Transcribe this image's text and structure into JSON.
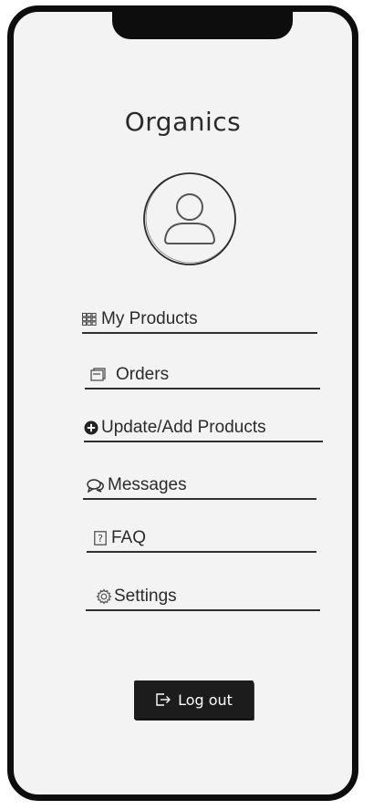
{
  "app": {
    "title": "Organics"
  },
  "menu": {
    "items": [
      {
        "label": "My Products",
        "icon": "grid-icon"
      },
      {
        "label": "Orders",
        "icon": "clipboard-icon"
      },
      {
        "label": "Update/Add Products",
        "icon": "plus-circle-icon"
      },
      {
        "label": "Messages",
        "icon": "chat-icon"
      },
      {
        "label": "FAQ",
        "icon": "question-icon"
      },
      {
        "label": "Settings",
        "icon": "gear-icon"
      }
    ]
  },
  "logout": {
    "label": "Log out",
    "icon": "logout-icon"
  }
}
